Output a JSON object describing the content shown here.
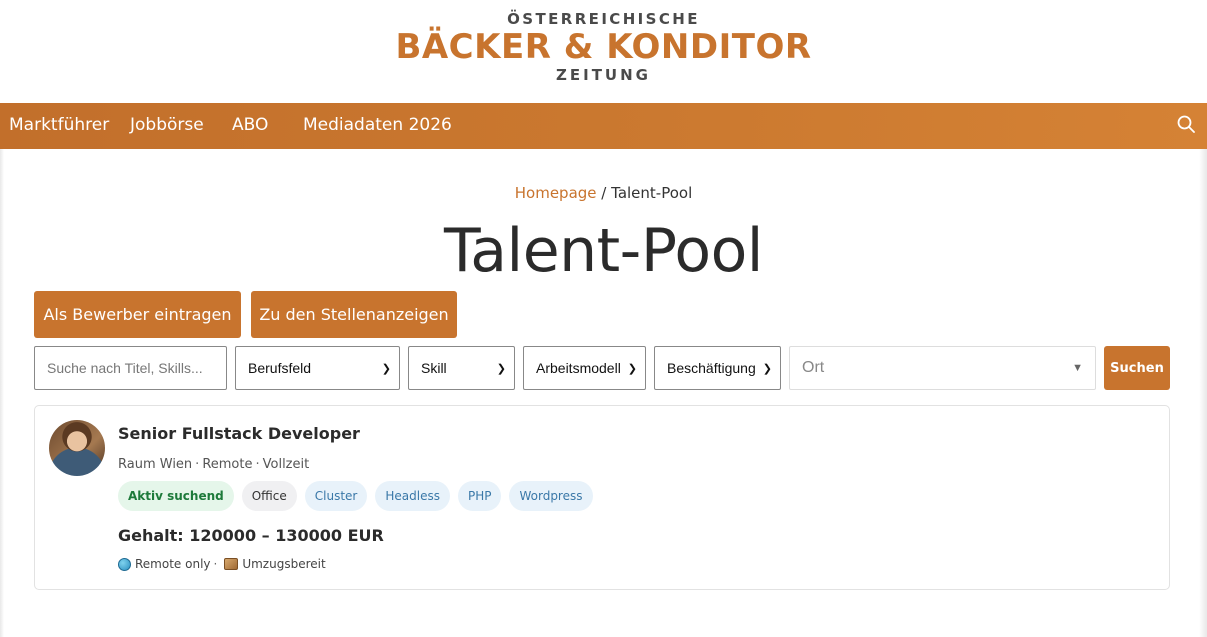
{
  "logo": {
    "line1": "ÖSTERREICHISCHE",
    "line2": "BÄCKER & KONDITOR",
    "line3": "ZEITUNG"
  },
  "nav": {
    "items": [
      "Marktführer",
      "Jobbörse",
      "ABO",
      "Mediadaten 2026"
    ],
    "search_icon": "search-icon"
  },
  "breadcrumb": {
    "home": "Homepage",
    "separator": "/",
    "current": "Talent-Pool"
  },
  "page": {
    "title": "Talent-Pool"
  },
  "actions": {
    "register_label": "Als Bewerber eintragen",
    "jobs_label": "Zu den Stellenanzeigen"
  },
  "filters": {
    "search_placeholder": "Suche nach Titel, Skills...",
    "field_select": "Berufsfeld",
    "skill_select": "Skill",
    "workmodel_select": "Arbeitsmodell",
    "employment_select": "Beschäftigung",
    "location_placeholder": "Ort",
    "search_button": "Suchen"
  },
  "results": [
    {
      "title": "Senior Fullstack Developer",
      "location": "Raum Wien",
      "work_model": "Remote",
      "employment": "Vollzeit",
      "status_tag": "Aktiv suchend",
      "tags": [
        "Office",
        "Cluster",
        "Headless",
        "PHP",
        "Wordpress"
      ],
      "salary": "Gehalt: 120000 – 130000 EUR",
      "remote_note": "Remote only",
      "relocation_note": "Umzugsbereit"
    }
  ],
  "colors": {
    "accent": "#c8742e",
    "status_green": "#1d7a3a",
    "skill_blue": "#3a78a8"
  }
}
